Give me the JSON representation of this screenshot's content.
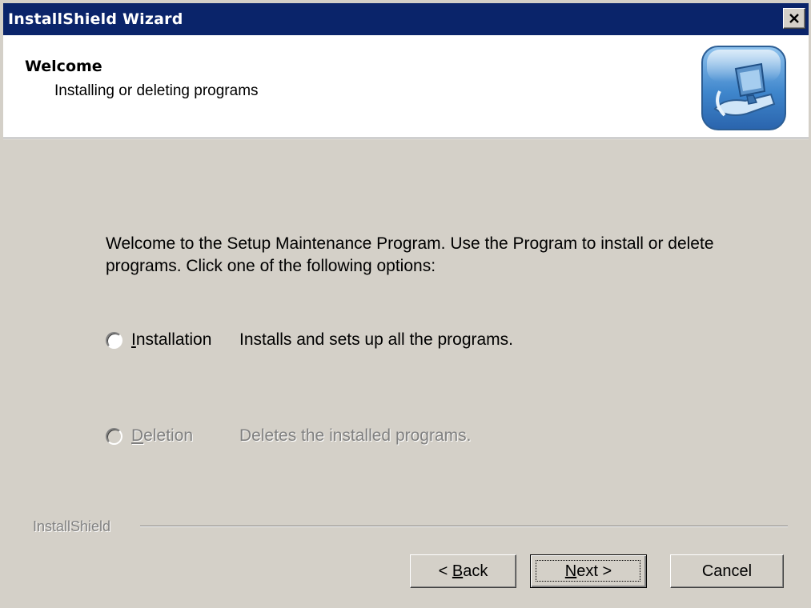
{
  "window": {
    "title": "InstallShield Wizard",
    "close_icon": "close-icon"
  },
  "header": {
    "title": "Welcome",
    "subtitle": "Installing or deleting programs",
    "icon": "setup-computer-icon"
  },
  "body": {
    "welcome_text": "Welcome to the Setup Maintenance Program.  Use the Program to install or delete programs.  Click one of the following options:"
  },
  "options": [
    {
      "label": "Installation",
      "accelerator": "I",
      "rest": "nstallation",
      "description": "Installs and sets up all the programs.",
      "enabled": true,
      "selected": false
    },
    {
      "label": "Deletion",
      "accelerator": "D",
      "rest": "eletion",
      "description": "Deletes the installed programs.",
      "enabled": false,
      "selected": false
    }
  ],
  "footer": {
    "brand": "InstallShield"
  },
  "buttons": {
    "back": {
      "prefix": "< ",
      "accelerator": "B",
      "rest": "ack"
    },
    "next": {
      "accelerator": "N",
      "rest": "ext",
      "suffix": " >"
    },
    "cancel": "Cancel"
  },
  "colors": {
    "titlebar": "#0a246a",
    "dialog_face": "#d4d0c8",
    "header_bg": "#ffffff",
    "disabled_text": "#808080"
  }
}
